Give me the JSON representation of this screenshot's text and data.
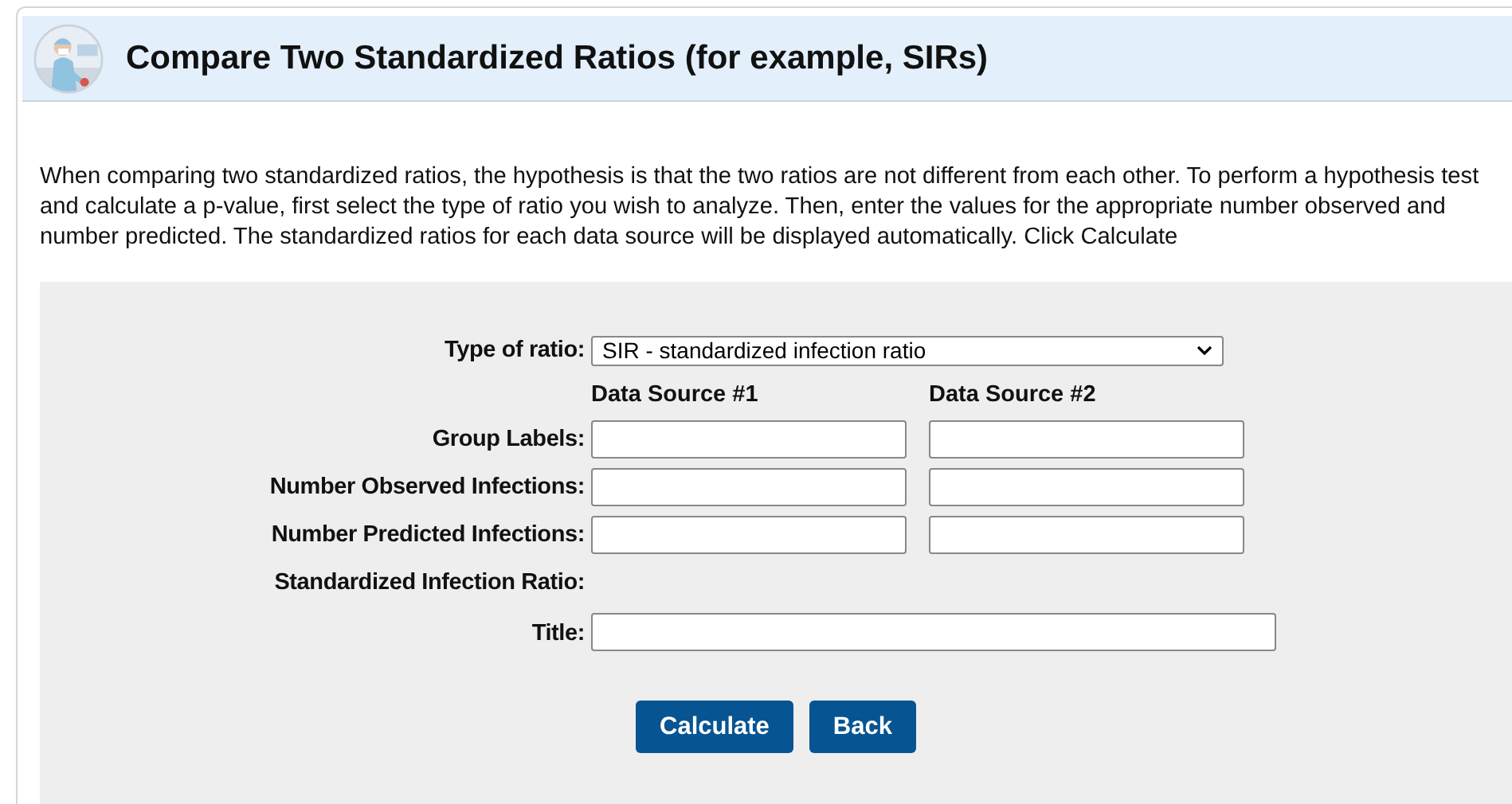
{
  "header": {
    "title": "Compare Two Standardized Ratios (for example, SIRs)"
  },
  "intro": "When comparing two standardized ratios, the hypothesis is that the two ratios are not different from each other. To perform a hypothesis test and calculate a p-value, first select the type of ratio you wish to analyze. Then, enter the values for the appropriate number observed and number predicted. The standardized ratios for each data source will be displayed automatically. Click Calculate",
  "form": {
    "type_label": "Type of ratio:",
    "type_value": "SIR - standardized infection ratio",
    "columns": [
      "Data Source #1",
      "Data Source #2"
    ],
    "rows": [
      {
        "label": "Group Labels:",
        "kind": "inputs"
      },
      {
        "label": "Number Observed Infections:",
        "kind": "inputs"
      },
      {
        "label": "Number Predicted Infections:",
        "kind": "inputs"
      },
      {
        "label": "Standardized Infection Ratio:",
        "kind": "display"
      },
      {
        "label": "Title:",
        "kind": "wide"
      }
    ],
    "buttons": [
      "Calculate",
      "Back"
    ]
  }
}
